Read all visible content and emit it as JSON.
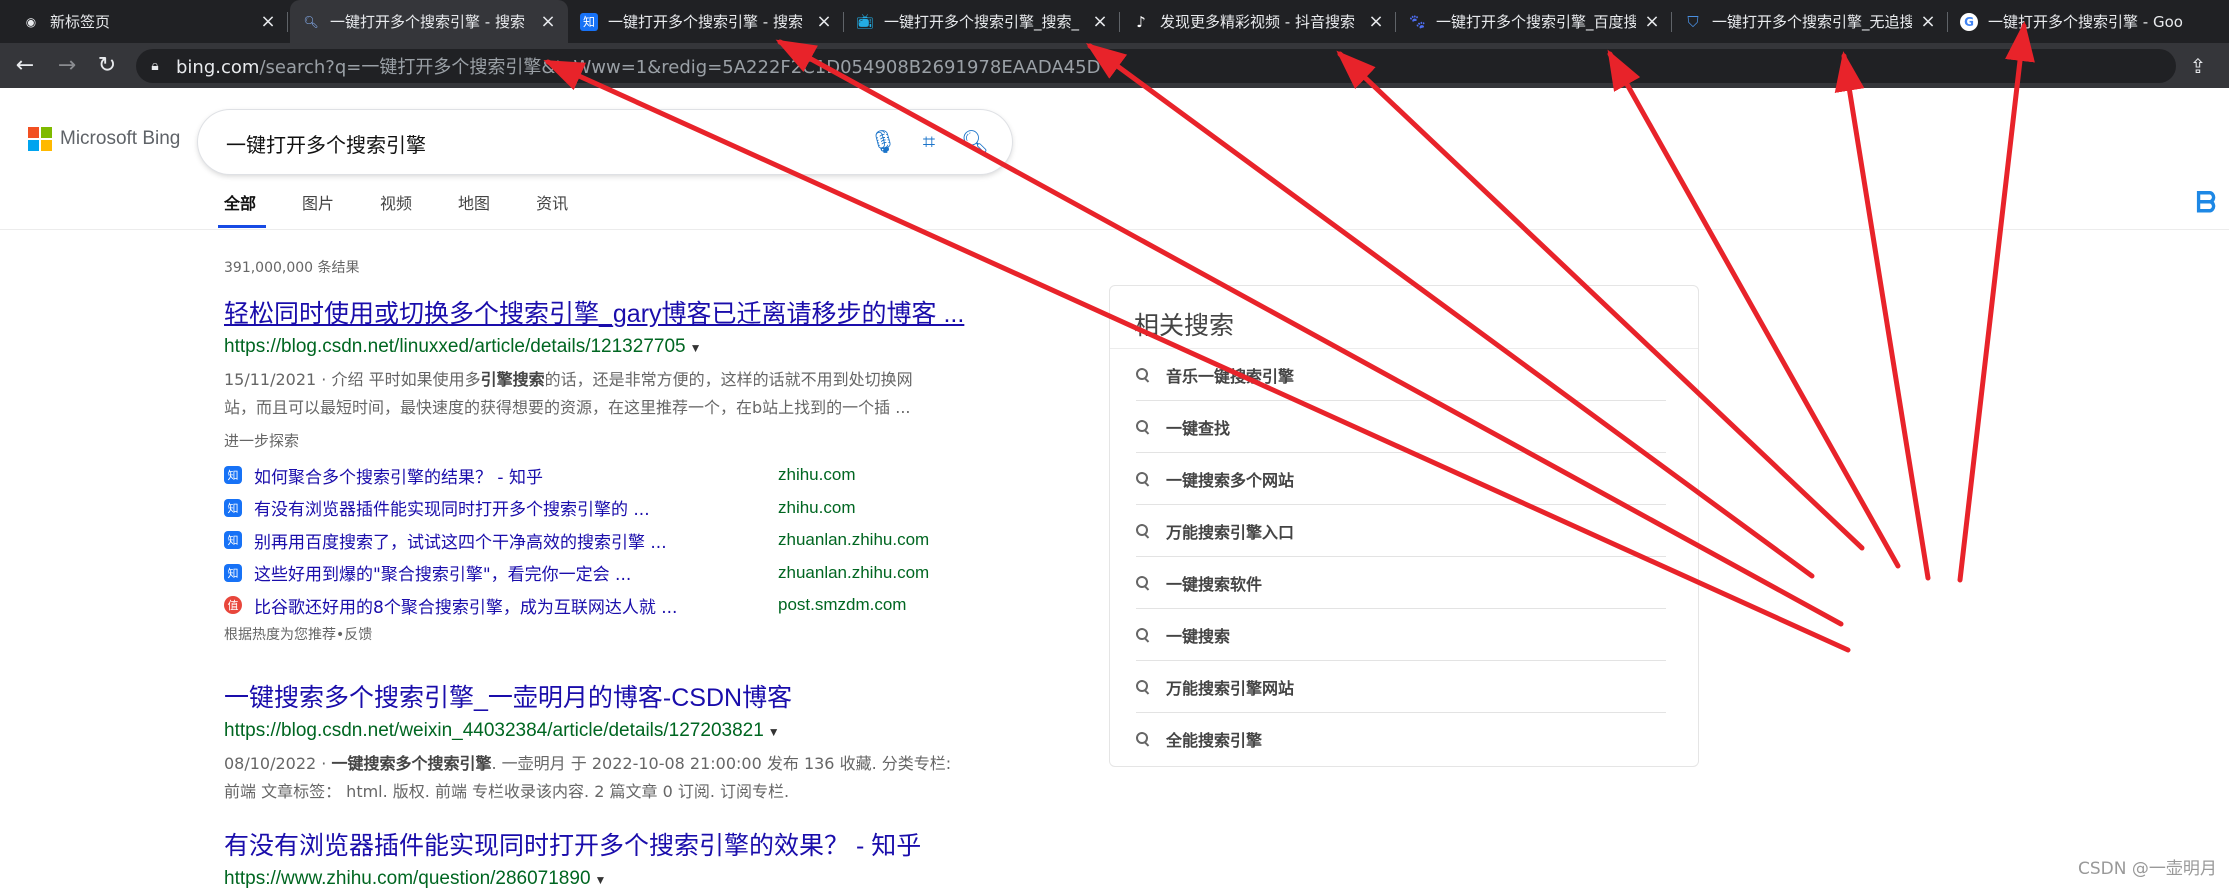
{
  "tabs": [
    {
      "label": "新标签页",
      "icon": "chrome-icon",
      "active": false
    },
    {
      "label": "一键打开多个搜索引擎 - 搜索",
      "icon": "bing-search-icon",
      "active": true
    },
    {
      "label": "一键打开多个搜索引擎 - 搜索",
      "icon": "zhihu-icon",
      "active": false
    },
    {
      "label": "一键打开多个搜索引擎_搜索_",
      "icon": "bilibili-icon",
      "active": false
    },
    {
      "label": "发现更多精彩视频 - 抖音搜索",
      "icon": "douyin-icon",
      "active": false
    },
    {
      "label": "一键打开多个搜索引擎_百度搜",
      "icon": "baidu-icon",
      "active": false
    },
    {
      "label": "一键打开多个搜索引擎_无追搜",
      "icon": "shield-icon",
      "active": false
    },
    {
      "label": "一键打开多个搜索引擎 - Goo",
      "icon": "google-icon",
      "active": false
    }
  ],
  "toolbar": {
    "url_host": "bing.com",
    "url_path": "/search?q=一键打开多个搜索引擎&toWww=1&redig=5A222F2C1D054908B2691978EAADA45D"
  },
  "bing": {
    "logo_text": "Microsoft Bing",
    "query": "一键打开多个搜索引擎",
    "nav": [
      "全部",
      "图片",
      "视频",
      "地图",
      "资讯"
    ],
    "result_count": "391,000,000 条结果"
  },
  "results": [
    {
      "title": "轻松同时使用或切换多个搜索引擎_gary博客已迁离请移步的博客 ...",
      "url": "https://blog.csdn.net/linuxxed/article/details/121327705",
      "snippet_line1_pre": "15/11/2021 · 介绍 平时如果使用多",
      "snippet_line1_bold": "引擎搜索",
      "snippet_line1_post": "的话，还是非常方便的，这样的话就不用到处切换网",
      "snippet_line2": "站，而且可以最短时间，最快速度的获得想要的资源，在这里推荐一个，在b站上找到的一个插 ..."
    },
    {
      "title": "一键搜索多个搜索引擎_一壶明月的博客-CSDN博客",
      "url": "https://blog.csdn.net/weixin_44032384/article/details/127203821",
      "snippet_line1_pre": "08/10/2022 · ",
      "snippet_line1_bold": "一键搜索多个搜索引擎",
      "snippet_line1_post": ". 一壶明月 于 2022-10-08 21:00:00 发布 136 收藏. 分类专栏:",
      "snippet_line2": "前端 文章标签： html. 版权. 前端 专栏收录该内容. 2 篇文章 0 订阅. 订阅专栏."
    },
    {
      "title": "有没有浏览器插件能实现同时打开多个搜索引擎的效果？ - 知乎",
      "url": "https://www.zhihu.com/question/286071890"
    }
  ],
  "explore": {
    "heading": "进一步探索",
    "items": [
      {
        "title": "如何聚合多个搜索引擎的结果？ - 知乎",
        "domain": "zhihu.com",
        "icon": "知"
      },
      {
        "title": "有没有浏览器插件能实现同时打开多个搜索引擎的 ...",
        "domain": "zhihu.com",
        "icon": "知"
      },
      {
        "title": "别再用百度搜索了，试试这四个干净高效的搜索引擎 ...",
        "domain": "zhuanlan.zhihu.com",
        "icon": "知"
      },
      {
        "title": "这些好用到爆的\"聚合搜索引擎\"，看完你一定会 ...",
        "domain": "zhuanlan.zhihu.com",
        "icon": "知"
      },
      {
        "title": "比谷歌还好用的8个聚合搜索引擎，成为互联网达人就 ...",
        "domain": "post.smzdm.com",
        "icon": "值"
      }
    ],
    "footer": "根据热度为您推荐•反馈"
  },
  "related": {
    "title": "相关搜索",
    "items": [
      "音乐一键搜索引擎",
      "一键查找",
      "一键搜索多个网站",
      "万能搜索引擎入口",
      "一键搜索软件",
      "一键搜索",
      "万能搜索引擎网站",
      "全能搜索引擎"
    ]
  },
  "watermark": "CSDN @一壶明月",
  "colors": {
    "arrow": "#e8232a",
    "link": "#1a0dab",
    "url_green": "#006621",
    "bing_blue": "#174ae4"
  }
}
